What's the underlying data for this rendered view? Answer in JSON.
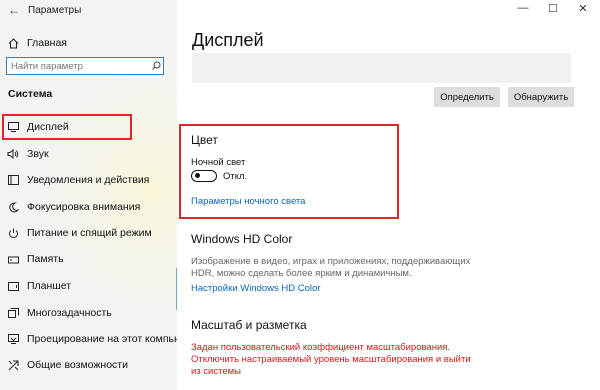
{
  "window": {
    "title": "Параметры",
    "back_icon": "back-arrow-icon",
    "controls": {
      "minimize": "—",
      "maximize": "☐",
      "close": "✕"
    }
  },
  "sidebar": {
    "home": {
      "label": "Главная",
      "icon": "home-icon"
    },
    "search": {
      "placeholder": "Найти параметр",
      "icon": "search-icon"
    },
    "section_label": "Система",
    "items": [
      {
        "label": "Дисплей",
        "icon": "monitor-icon",
        "selected": true
      },
      {
        "label": "Звук",
        "icon": "speaker-icon"
      },
      {
        "label": "Уведомления и действия",
        "icon": "notifications-icon"
      },
      {
        "label": "Фокусировка внимания",
        "icon": "focus-assist-icon"
      },
      {
        "label": "Питание и спящий режим",
        "icon": "power-icon"
      },
      {
        "label": "Память",
        "icon": "storage-icon"
      },
      {
        "label": "Планшет",
        "icon": "tablet-icon"
      },
      {
        "label": "Многозадачность",
        "icon": "multitasking-icon"
      },
      {
        "label": "Проецирование на этот компьютер",
        "icon": "projecting-icon"
      },
      {
        "label": "Общие возможности",
        "icon": "shared-experiences-icon"
      }
    ]
  },
  "main": {
    "title": "Дисплей",
    "buttons": {
      "identify": "Определить",
      "detect": "Обнаружить"
    },
    "color": {
      "heading": "Цвет",
      "night_light_label": "Ночной свет",
      "night_light_state": "Откл.",
      "night_light_link": "Параметры ночного света"
    },
    "hdr": {
      "heading": "Windows HD Color",
      "desc_line1": "Изображение в видео, играх и приложениях, поддерживающих",
      "desc_line2": "HDR, можно сделать более ярким и динамичным.",
      "link": "Настройки Windows HD Color"
    },
    "scale": {
      "heading": "Масштаб и разметка",
      "warn_line1": "Задан пользовательский коэффициент масштабирования.",
      "warn_line2": "Отключить настраиваемый уровень масштабирования и выйти",
      "warn_line3": "из системы"
    }
  },
  "colors": {
    "accent": "#0a66b8",
    "highlight": "#e0262b",
    "warning": "#d41818"
  }
}
